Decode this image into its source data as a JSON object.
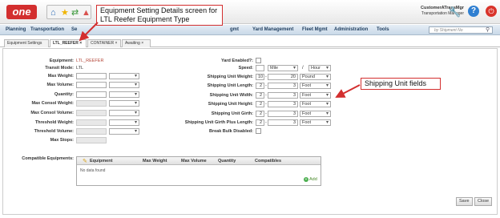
{
  "app": {
    "logo": "one",
    "user_name": "CustomerATransMgr",
    "user_role": "Transportation Manager"
  },
  "menu": [
    "Planning",
    "Transportation",
    "Se",
    "gmt",
    "Yard Management",
    "Fleet Mgmt",
    "Administration",
    "Tools"
  ],
  "search": {
    "placeholder": "by Shipment No"
  },
  "tabs": [
    "Equipment Settings",
    "LTL_REEFER",
    "CONTAINER",
    "Awaiting"
  ],
  "left_form": {
    "equipment_label": "Equipment:",
    "equipment_value": "LTL_REEFER",
    "transit_mode_label": "Transit Mode:",
    "transit_mode_value": "LTL",
    "fields": [
      "Max Weight:",
      "Max Volume:",
      "Quantity:",
      "Max Consol Weight:",
      "Max Consol Volume:",
      "Threshold Weight:",
      "Threshold Volume:",
      "Max Stops:"
    ]
  },
  "right_form": {
    "yard_enabled_label": "Yard Enabled?:",
    "speed_label": "Speed:",
    "speed_unit": "Mile",
    "speed_sep": "/",
    "speed_time": "Hour",
    "fields": [
      {
        "label": "Shipping Unit Weight:",
        "a": "10",
        "b": "20",
        "unit": "Pound"
      },
      {
        "label": "Shipping Unit Length:",
        "a": "2",
        "b": "3",
        "unit": "Foot"
      },
      {
        "label": "Shipping Unit Width:",
        "a": "2",
        "b": "3",
        "unit": "Foot"
      },
      {
        "label": "Shipping Unit Height:",
        "a": "2",
        "b": "3",
        "unit": "Foot"
      },
      {
        "label": "Shipping Unit Girth:",
        "a": "2",
        "b": "3",
        "unit": "Foot"
      },
      {
        "label": "Shipping Unit Girth Plus Length:",
        "a": "2",
        "b": "3",
        "unit": "Foot"
      }
    ],
    "dash": "-",
    "break_bulk_label": "Break Bulk Disabled:"
  },
  "compatible": {
    "label": "Compatible Equipments:",
    "columns": [
      "Equipment",
      "Max Weight",
      "Max Volume",
      "Quantity",
      "Compatibles"
    ],
    "empty": "No data found",
    "add": "Add"
  },
  "buttons": {
    "save": "Save",
    "close": "Close"
  },
  "callouts": {
    "title": "Equipment Setting Details screen for LTL Reefer Equipment Type",
    "fields": "Shipping Unit fields"
  },
  "colors": {
    "callout_border": "#d32f2f",
    "accent": "#1d3c5e"
  }
}
